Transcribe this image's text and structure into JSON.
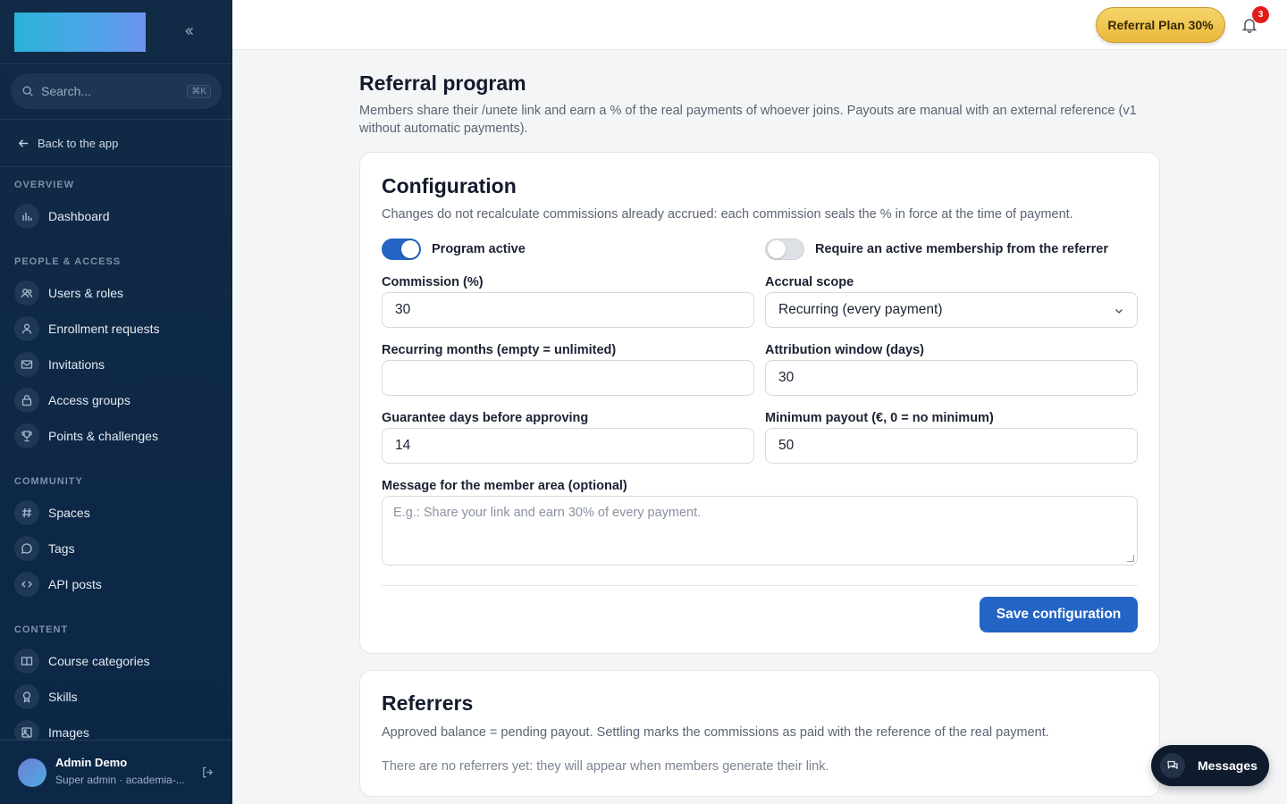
{
  "sidebar": {
    "search": {
      "placeholder": "Search...",
      "shortcut": "⌘K"
    },
    "back_label": "Back to the app",
    "sections": {
      "overview": "OVERVIEW",
      "people": "PEOPLE & ACCESS",
      "community": "COMMUNITY",
      "content": "CONTENT"
    },
    "items": {
      "dashboard": "Dashboard",
      "users": "Users & roles",
      "enrollment": "Enrollment requests",
      "invitations": "Invitations",
      "access_groups": "Access groups",
      "points": "Points & challenges",
      "spaces": "Spaces",
      "tags": "Tags",
      "api_posts": "API posts",
      "course_categories": "Course categories",
      "skills": "Skills",
      "images": "Images"
    },
    "user": {
      "name": "Admin Demo",
      "role": "Super admin · academia-..."
    }
  },
  "topbar": {
    "plan_badge": "Referral Plan 30%",
    "notification_count": "3"
  },
  "page": {
    "title": "Referral program",
    "description": "Members share their /unete link and earn a % of the real payments of whoever joins. Payouts are manual with an external reference (v1 without automatic payments)."
  },
  "config": {
    "title": "Configuration",
    "subtitle": "Changes do not recalculate commissions already accrued: each commission seals the % in force at the time of payment.",
    "program_active_label": "Program active",
    "program_active": true,
    "require_membership_label": "Require an active membership from the referrer",
    "require_membership": false,
    "commission_label": "Commission (%)",
    "commission_value": "30",
    "accrual_label": "Accrual scope",
    "accrual_value": "Recurring (every payment)",
    "recurring_label": "Recurring months (empty = unlimited)",
    "recurring_value": "",
    "attribution_label": "Attribution window (days)",
    "attribution_value": "30",
    "guarantee_label": "Guarantee days before approving",
    "guarantee_value": "14",
    "min_payout_label": "Minimum payout (€, 0 = no minimum)",
    "min_payout_value": "50",
    "message_label": "Message for the member area (optional)",
    "message_placeholder": "E.g.: Share your link and earn 30% of every payment.",
    "save_label": "Save configuration"
  },
  "referrers": {
    "title": "Referrers",
    "subtitle": "Approved balance = pending payout. Settling marks the commissions as paid with the reference of the real payment.",
    "empty": "There are no referrers yet: they will appear when members generate their link."
  },
  "messages_label": "Messages",
  "colors": {
    "accent": "#2364c4",
    "sidebar": "#0f2a47",
    "badge": "#f0c654",
    "alert": "#e21b1b"
  }
}
